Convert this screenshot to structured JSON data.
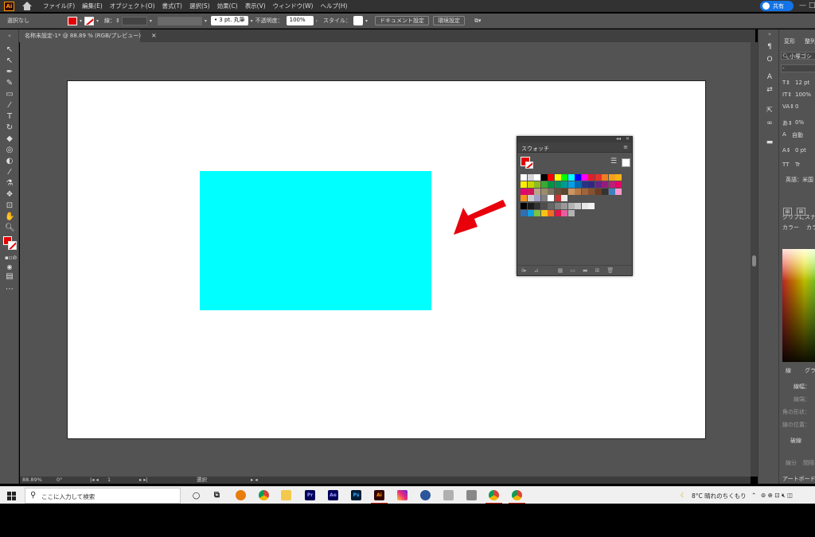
{
  "app": {
    "logo": "Ai",
    "menus": [
      "ファイル(F)",
      "編集(E)",
      "オブジェクト(O)",
      "書式(T)",
      "選択(S)",
      "効果(C)",
      "表示(V)",
      "ウィンドウ(W)",
      "ヘルプ(H)"
    ],
    "share_label": "共有",
    "window_controls": [
      "—",
      "□",
      "✕"
    ]
  },
  "control": {
    "selection": "選択なし",
    "stroke_label": "線：",
    "brush_label": "3 pt. 丸筆",
    "opacity_label": "不透明度：",
    "opacity_value": "100%",
    "style_label": "スタイル：",
    "doc_setup": "ドキュメント設定",
    "prefs": "環境設定"
  },
  "document": {
    "tab_title": "名称未設定-1* @ 88.89 % (RGB/プレビュー)",
    "close_glyph": "×"
  },
  "canvas": {
    "rect_color": "#00ffff",
    "arrow_color": "#e8000b"
  },
  "swatches": {
    "collapse_glyph": "◂◂",
    "close_glyph": "✕",
    "title": "スウォッチ",
    "menu_glyph": "≡",
    "rows": [
      [
        "#ffffff",
        "#d6d6d6",
        "#ffffff",
        "#000000",
        "#ff0000",
        "#ffff00",
        "#00ff00",
        "#00ffff",
        "#0000ff",
        "#ff00ff",
        "#e61e28",
        "#e6322d",
        "#ef7d22",
        "#f6a01a",
        "#fbb017"
      ],
      [
        "#ffed00",
        "#c8d400",
        "#8cbe22",
        "#3aa935",
        "#009640",
        "#00935f",
        "#009a93",
        "#00a0e3",
        "#0069b4",
        "#283583",
        "#312783",
        "#662483",
        "#951b81",
        "#be1e78",
        "#e50066"
      ],
      [
        "#e6006e",
        "#d4145a",
        "#b8a48a",
        "#9b8c6e",
        "#7d7362",
        "#66513c",
        "#5b4632",
        "#c89664",
        "#b97846",
        "#a0643c",
        "#87502d",
        "#6e3c1e",
        "#333333",
        "#4080c0",
        "#ff99cc"
      ],
      [
        "#f7931e",
        "#cccccc",
        "#a0a0c8",
        "#808080",
        "#ffffff",
        "#cc3333",
        "#eeeeee"
      ],
      [
        "#000000",
        "#1a1a1a",
        "#333333",
        "#4d4d4d",
        "#666666",
        "#808080",
        "#999999",
        "#b3b3b3",
        "#cccccc",
        "#e6e6e6",
        "#f2f2f2"
      ],
      [
        "#2e6fb5",
        "#0fa0e0",
        "#7ec242",
        "#f7c118",
        "#ef6b23",
        "#e5134a",
        "#e65fa1",
        "#b3b3b3"
      ]
    ],
    "bottom_icons": [
      "ⅱ▸",
      "⊿",
      "▦",
      "▭",
      "▬",
      "⊞",
      "🗑"
    ]
  },
  "status": {
    "zoom": "88.89%",
    "rotation": "0°",
    "page": "1",
    "tool": "選択"
  },
  "properties": {
    "tabs": [
      "変形",
      "整列"
    ],
    "font": "小塚ゴシ",
    "font_dash": "-",
    "size": "12 pt",
    "scale": "100%",
    "tracking": "0",
    "tsume": "0%",
    "auto": "自動",
    "baseline": "0 pt",
    "tt1": "TT",
    "tt2": "Tr",
    "language": "英語：米国",
    "glyph_snap": "グリフにスナ",
    "color_tab": "カラー",
    "color_tab2": "カラ",
    "stroke_tab": "線",
    "grad_tab": "グラ",
    "stroke_width": "線幅：",
    "stroke_cap": "線端：",
    "stroke_corner": "角の形状：",
    "stroke_align": "線の位置：",
    "dash_label": "破線",
    "dash_segment": "線分",
    "dash_gap": "間隔",
    "artboard": "アートボード"
  },
  "taskbar": {
    "search_placeholder": "ここに入力して検索",
    "weather": "8°C  晴れのちくもり",
    "apps": [
      "Pr",
      "Ae",
      "Ps",
      "Ai"
    ]
  }
}
